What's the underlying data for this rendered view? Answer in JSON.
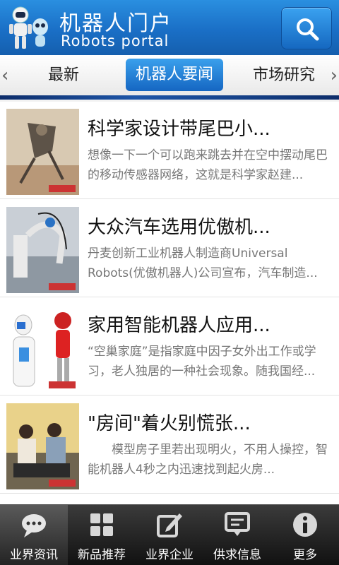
{
  "header": {
    "title_cn": "机器人门户",
    "title_en": "Robots portal",
    "search_icon": "search-icon"
  },
  "tabs": {
    "items": [
      {
        "label": "最新"
      },
      {
        "label": "机器人要闻",
        "selected": true
      },
      {
        "label": "市场研究"
      }
    ],
    "left_arrow": "‹",
    "right_arrow": "›"
  },
  "news": [
    {
      "title": "科学家设计带尾巴小...",
      "desc": "想像一下一个可以跑来跳去并在空中摆动尾巴的移动传感器网络，这就是科学家赵建..."
    },
    {
      "title": "大众汽车选用优傲机...",
      "desc": "丹麦创新工业机器人制造商Universal Robots(优傲机器人)公司宣布，汽车制造..."
    },
    {
      "title": "家用智能机器人应用...",
      "desc": "“空巢家庭”是指家庭中因子女外出工作或学习，老人独居的一种社会现象。随我国经..."
    },
    {
      "title": "\"房间\"着火别慌张...",
      "desc": "　　模型房子里若出现明火，不用人操控，智能机器人4秒之内迅速找到起火房..."
    }
  ],
  "bottom_nav": [
    {
      "label": "业界资讯",
      "icon": "chat-bubbles-icon",
      "active": true
    },
    {
      "label": "新品推荐",
      "icon": "grid-icon"
    },
    {
      "label": "业界企业",
      "icon": "edit-icon"
    },
    {
      "label": "供求信息",
      "icon": "message-icon"
    },
    {
      "label": "更多",
      "icon": "info-icon"
    }
  ],
  "colors": {
    "header_blue": "#1a6fc6",
    "tab_selected": "#1566c2",
    "nav_bg": "#111111"
  }
}
